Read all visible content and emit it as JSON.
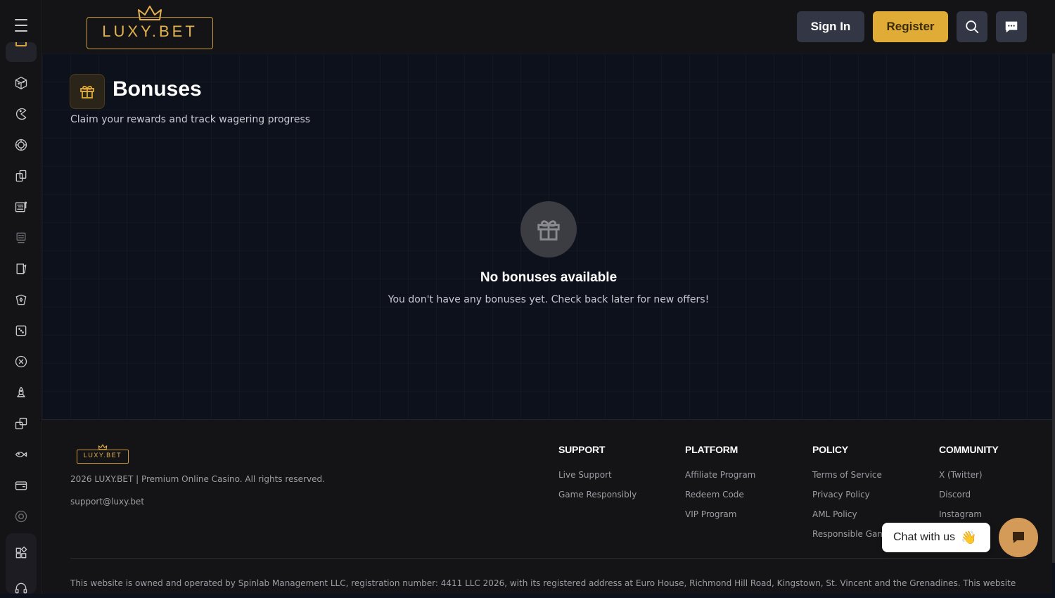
{
  "header": {
    "logo_text": "LUXY.BET",
    "signin_label": "Sign In",
    "register_label": "Register",
    "search_icon": "search-icon",
    "messages_icon": "chat-icon"
  },
  "sidebar": {
    "menu_icon": "hamburger-menu-icon",
    "items": [
      {
        "icon": "gift-icon",
        "active": true
      },
      {
        "icon": "cube-icon"
      },
      {
        "icon": "pacman-icon"
      },
      {
        "icon": "chip-icon"
      },
      {
        "icon": "cards-icon"
      },
      {
        "icon": "slot-machine-icon"
      },
      {
        "icon": "live-casino-icon"
      },
      {
        "icon": "card-game-icon"
      },
      {
        "icon": "poker-cards-icon"
      },
      {
        "icon": "dice-icon"
      },
      {
        "icon": "roulette-icon"
      },
      {
        "icon": "rocket-icon"
      },
      {
        "icon": "dice-pair-icon"
      },
      {
        "icon": "fish-icon"
      },
      {
        "icon": "wallet-icon"
      },
      {
        "icon": "at-icon"
      },
      {
        "icon": "apps-icon"
      },
      {
        "icon": "headset-icon"
      }
    ]
  },
  "main": {
    "title": "Bonuses",
    "subtitle": "Claim your rewards and track wagering progress",
    "empty_title": "No bonuses available",
    "empty_text": "You don't have any bonuses yet. Check back later for new offers!"
  },
  "footer": {
    "logo_text": "LUXY.BET",
    "copyright": "2026 LUXY.BET | Premium Online Casino. All rights reserved.",
    "email": "support@luxy.bet",
    "columns": [
      {
        "title": "SUPPORT",
        "links": [
          "Live Support",
          "Game Responsibly"
        ]
      },
      {
        "title": "PLATFORM",
        "links": [
          "Affiliate Program",
          "Redeem Code",
          "VIP Program"
        ]
      },
      {
        "title": "POLICY",
        "links": [
          "Terms of Service",
          "Privacy Policy",
          "AML Policy",
          "Responsible Gam"
        ]
      },
      {
        "title": "COMMUNITY",
        "links": [
          "X (Twitter)",
          "Discord",
          "Instagram"
        ]
      }
    ],
    "legal": "This website is owned and operated by Spinlab Management LLC, registration number: 4411 LLC 2026, with its registered address at Euro House, Richmond Hill Road, Kingstown, St. Vincent and the Grenadines. This website"
  },
  "chat": {
    "label": "Chat with us",
    "emoji": "👋"
  },
  "colors": {
    "accent": "#e1ac36",
    "background": "#0d111c",
    "panel": "#141416",
    "button_dark": "#323645",
    "chat_bubble": "#d49a58"
  }
}
